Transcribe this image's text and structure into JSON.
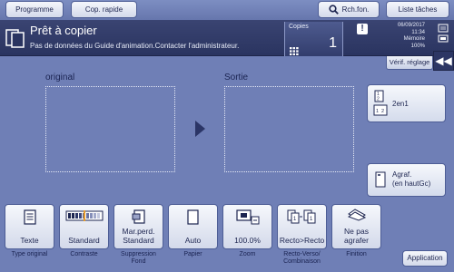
{
  "topbar": {
    "programme_label": "Programme",
    "copie_rapide_label": "Cop. rapide",
    "search_label": "Rch.fon.",
    "tasks_label": "Liste tâches"
  },
  "header": {
    "title": "Prêt à copier",
    "message": "Pas de données du Guide d'animation.Contacter l'administrateur.",
    "copies_label": "Copies",
    "copies_value": "1",
    "date": "06/09/2017",
    "time": "11:34",
    "memory_label": "Mémoire",
    "memory_value": "100%"
  },
  "main": {
    "verify_label": "Vérif. réglage",
    "original_label": "original",
    "sortie_label": "Sortie"
  },
  "side": {
    "combine_label": "2en1",
    "staple_label_1": "Agraf.",
    "staple_label_2": "(en hautGc)"
  },
  "functions": [
    {
      "value": "Texte",
      "caption": "Type original",
      "icon": "document-icon"
    },
    {
      "value": "Standard",
      "caption": "Contraste",
      "icon": "density-scale-icon"
    },
    {
      "value_line1": "Mar.perd.",
      "value_line2": "Standard",
      "caption_line1": "Suppression",
      "caption_line2": "Fond",
      "icon": "background-removal-icon"
    },
    {
      "value": "Auto",
      "caption": "Papier",
      "icon": "paper-icon"
    },
    {
      "value": "100.0%",
      "caption": "Zoom",
      "icon": "zoom-icon"
    },
    {
      "value": "Recto>Recto",
      "caption_line1": "Recto-Verso/",
      "caption_line2": "Combinaison",
      "icon": "duplex-icon"
    },
    {
      "value_line1": "Ne pas",
      "value_line2": "agrafer",
      "caption": "Finition",
      "icon": "finishing-icon"
    }
  ],
  "application_label": "Application",
  "colors": {
    "background": "#6f7fb6",
    "header": "#2a3460",
    "button": "#e4e9f4",
    "text_dark": "#1d2550"
  }
}
